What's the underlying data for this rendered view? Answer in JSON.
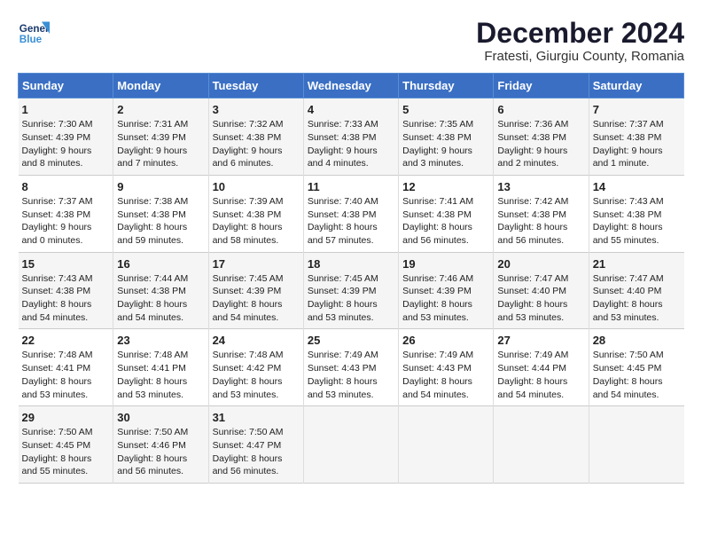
{
  "header": {
    "logo_line1": "General",
    "logo_line2": "Blue",
    "title": "December 2024",
    "subtitle": "Fratesti, Giurgiu County, Romania"
  },
  "weekdays": [
    "Sunday",
    "Monday",
    "Tuesday",
    "Wednesday",
    "Thursday",
    "Friday",
    "Saturday"
  ],
  "weeks": [
    [
      {
        "day": "1",
        "sunrise": "Sunrise: 7:30 AM",
        "sunset": "Sunset: 4:39 PM",
        "daylight": "Daylight: 9 hours and 8 minutes."
      },
      {
        "day": "2",
        "sunrise": "Sunrise: 7:31 AM",
        "sunset": "Sunset: 4:39 PM",
        "daylight": "Daylight: 9 hours and 7 minutes."
      },
      {
        "day": "3",
        "sunrise": "Sunrise: 7:32 AM",
        "sunset": "Sunset: 4:38 PM",
        "daylight": "Daylight: 9 hours and 6 minutes."
      },
      {
        "day": "4",
        "sunrise": "Sunrise: 7:33 AM",
        "sunset": "Sunset: 4:38 PM",
        "daylight": "Daylight: 9 hours and 4 minutes."
      },
      {
        "day": "5",
        "sunrise": "Sunrise: 7:35 AM",
        "sunset": "Sunset: 4:38 PM",
        "daylight": "Daylight: 9 hours and 3 minutes."
      },
      {
        "day": "6",
        "sunrise": "Sunrise: 7:36 AM",
        "sunset": "Sunset: 4:38 PM",
        "daylight": "Daylight: 9 hours and 2 minutes."
      },
      {
        "day": "7",
        "sunrise": "Sunrise: 7:37 AM",
        "sunset": "Sunset: 4:38 PM",
        "daylight": "Daylight: 9 hours and 1 minute."
      }
    ],
    [
      {
        "day": "8",
        "sunrise": "Sunrise: 7:37 AM",
        "sunset": "Sunset: 4:38 PM",
        "daylight": "Daylight: 9 hours and 0 minutes."
      },
      {
        "day": "9",
        "sunrise": "Sunrise: 7:38 AM",
        "sunset": "Sunset: 4:38 PM",
        "daylight": "Daylight: 8 hours and 59 minutes."
      },
      {
        "day": "10",
        "sunrise": "Sunrise: 7:39 AM",
        "sunset": "Sunset: 4:38 PM",
        "daylight": "Daylight: 8 hours and 58 minutes."
      },
      {
        "day": "11",
        "sunrise": "Sunrise: 7:40 AM",
        "sunset": "Sunset: 4:38 PM",
        "daylight": "Daylight: 8 hours and 57 minutes."
      },
      {
        "day": "12",
        "sunrise": "Sunrise: 7:41 AM",
        "sunset": "Sunset: 4:38 PM",
        "daylight": "Daylight: 8 hours and 56 minutes."
      },
      {
        "day": "13",
        "sunrise": "Sunrise: 7:42 AM",
        "sunset": "Sunset: 4:38 PM",
        "daylight": "Daylight: 8 hours and 56 minutes."
      },
      {
        "day": "14",
        "sunrise": "Sunrise: 7:43 AM",
        "sunset": "Sunset: 4:38 PM",
        "daylight": "Daylight: 8 hours and 55 minutes."
      }
    ],
    [
      {
        "day": "15",
        "sunrise": "Sunrise: 7:43 AM",
        "sunset": "Sunset: 4:38 PM",
        "daylight": "Daylight: 8 hours and 54 minutes."
      },
      {
        "day": "16",
        "sunrise": "Sunrise: 7:44 AM",
        "sunset": "Sunset: 4:38 PM",
        "daylight": "Daylight: 8 hours and 54 minutes."
      },
      {
        "day": "17",
        "sunrise": "Sunrise: 7:45 AM",
        "sunset": "Sunset: 4:39 PM",
        "daylight": "Daylight: 8 hours and 54 minutes."
      },
      {
        "day": "18",
        "sunrise": "Sunrise: 7:45 AM",
        "sunset": "Sunset: 4:39 PM",
        "daylight": "Daylight: 8 hours and 53 minutes."
      },
      {
        "day": "19",
        "sunrise": "Sunrise: 7:46 AM",
        "sunset": "Sunset: 4:39 PM",
        "daylight": "Daylight: 8 hours and 53 minutes."
      },
      {
        "day": "20",
        "sunrise": "Sunrise: 7:47 AM",
        "sunset": "Sunset: 4:40 PM",
        "daylight": "Daylight: 8 hours and 53 minutes."
      },
      {
        "day": "21",
        "sunrise": "Sunrise: 7:47 AM",
        "sunset": "Sunset: 4:40 PM",
        "daylight": "Daylight: 8 hours and 53 minutes."
      }
    ],
    [
      {
        "day": "22",
        "sunrise": "Sunrise: 7:48 AM",
        "sunset": "Sunset: 4:41 PM",
        "daylight": "Daylight: 8 hours and 53 minutes."
      },
      {
        "day": "23",
        "sunrise": "Sunrise: 7:48 AM",
        "sunset": "Sunset: 4:41 PM",
        "daylight": "Daylight: 8 hours and 53 minutes."
      },
      {
        "day": "24",
        "sunrise": "Sunrise: 7:48 AM",
        "sunset": "Sunset: 4:42 PM",
        "daylight": "Daylight: 8 hours and 53 minutes."
      },
      {
        "day": "25",
        "sunrise": "Sunrise: 7:49 AM",
        "sunset": "Sunset: 4:43 PM",
        "daylight": "Daylight: 8 hours and 53 minutes."
      },
      {
        "day": "26",
        "sunrise": "Sunrise: 7:49 AM",
        "sunset": "Sunset: 4:43 PM",
        "daylight": "Daylight: 8 hours and 54 minutes."
      },
      {
        "day": "27",
        "sunrise": "Sunrise: 7:49 AM",
        "sunset": "Sunset: 4:44 PM",
        "daylight": "Daylight: 8 hours and 54 minutes."
      },
      {
        "day": "28",
        "sunrise": "Sunrise: 7:50 AM",
        "sunset": "Sunset: 4:45 PM",
        "daylight": "Daylight: 8 hours and 54 minutes."
      }
    ],
    [
      {
        "day": "29",
        "sunrise": "Sunrise: 7:50 AM",
        "sunset": "Sunset: 4:45 PM",
        "daylight": "Daylight: 8 hours and 55 minutes."
      },
      {
        "day": "30",
        "sunrise": "Sunrise: 7:50 AM",
        "sunset": "Sunset: 4:46 PM",
        "daylight": "Daylight: 8 hours and 56 minutes."
      },
      {
        "day": "31",
        "sunrise": "Sunrise: 7:50 AM",
        "sunset": "Sunset: 4:47 PM",
        "daylight": "Daylight: 8 hours and 56 minutes."
      },
      {
        "day": "",
        "sunrise": "",
        "sunset": "",
        "daylight": ""
      },
      {
        "day": "",
        "sunrise": "",
        "sunset": "",
        "daylight": ""
      },
      {
        "day": "",
        "sunrise": "",
        "sunset": "",
        "daylight": ""
      },
      {
        "day": "",
        "sunrise": "",
        "sunset": "",
        "daylight": ""
      }
    ]
  ]
}
